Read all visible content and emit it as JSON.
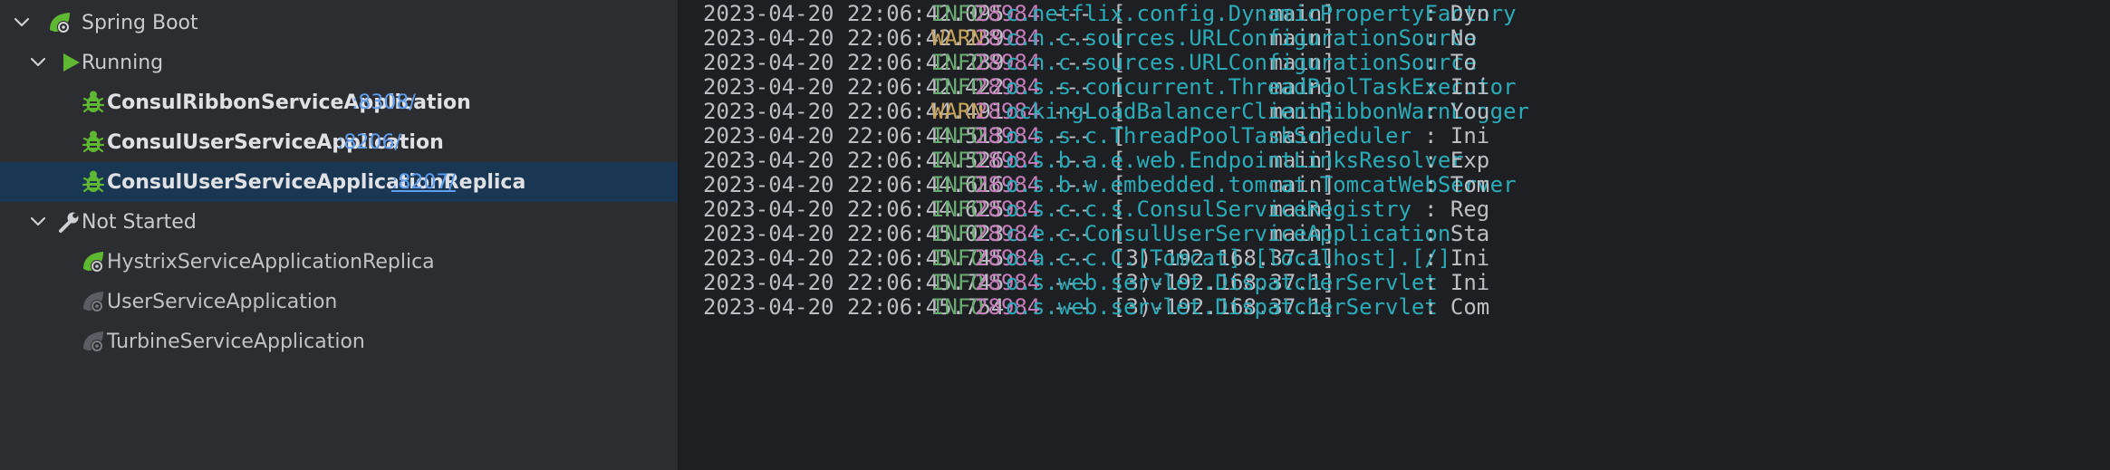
{
  "tree": {
    "root": {
      "label": "Spring Boot"
    },
    "running": {
      "label": "Running",
      "apps": [
        {
          "name": "ConsulRibbonServiceApplication",
          "port": ":8308/"
        },
        {
          "name": "ConsulUserServiceApplication",
          "port": ":8206/"
        },
        {
          "name": "ConsulUserServiceApplicationReplica",
          "port": ":8207/"
        }
      ]
    },
    "not_started": {
      "label": "Not Started",
      "apps": [
        {
          "name": "HystrixServiceApplicationReplica"
        },
        {
          "name": "UserServiceApplication"
        },
        {
          "name": "TurbineServiceApplication"
        }
      ]
    }
  },
  "console": {
    "lines": [
      {
        "ts": "2023-04-20 22:06:42.095",
        "level": "INFO",
        "pid": "28984",
        "sep": "---",
        "thread": "[           main]",
        "logger": "c.netflix.config.DynamicPropertyFactory",
        "msg": ": Dyn"
      },
      {
        "ts": "2023-04-20 22:06:42.239",
        "level": "WARN",
        "pid": "28984",
        "sep": "---",
        "thread": "[           main]",
        "logger": "c.n.c.sources.URLConfigurationSource",
        "msg": ": No"
      },
      {
        "ts": "2023-04-20 22:06:42.239",
        "level": "INFO",
        "pid": "28984",
        "sep": "---",
        "thread": "[           main]",
        "logger": "c.n.c.sources.URLConfigurationSource",
        "msg": ": To"
      },
      {
        "ts": "2023-04-20 22:06:42.422",
        "level": "INFO",
        "pid": "28984",
        "sep": "---",
        "thread": "[           main]",
        "logger": "o.s.s.concurrent.ThreadPoolTaskExecutor",
        "msg": ": Ini"
      },
      {
        "ts": "2023-04-20 22:06:44.491",
        "level": "WARN",
        "pid": "28984",
        "sep": "---",
        "thread": "[           main]",
        "logger": "ockingLoadBalancerClientRibbonWarnLogger",
        "msg": ": You"
      },
      {
        "ts": "2023-04-20 22:06:44.513",
        "level": "INFO",
        "pid": "28984",
        "sep": "---",
        "thread": "[           main]",
        "logger": "o.s.s.c.ThreadPoolTaskScheduler",
        "msg": ": Ini"
      },
      {
        "ts": "2023-04-20 22:06:44.526",
        "level": "INFO",
        "pid": "28984",
        "sep": "---",
        "thread": "[           main]",
        "logger": "o.s.b.a.e.web.EndpointLinksResolver",
        "msg": ": Exp"
      },
      {
        "ts": "2023-04-20 22:06:44.616",
        "level": "INFO",
        "pid": "28984",
        "sep": "---",
        "thread": "[           main]",
        "logger": "o.s.b.w.embedded.tomcat.TomcatWebServer",
        "msg": ": Tom"
      },
      {
        "ts": "2023-04-20 22:06:44.625",
        "level": "INFO",
        "pid": "28984",
        "sep": "---",
        "thread": "[           main]",
        "logger": "o.s.c.c.s.ConsulServiceRegistry",
        "msg": ": Reg"
      },
      {
        "ts": "2023-04-20 22:06:45.023",
        "level": "INFO",
        "pid": "28984",
        "sep": "---",
        "thread": "[           main]",
        "logger": "c.e.c.ConsulUserServiceApplication",
        "msg": ": Sta"
      },
      {
        "ts": "2023-04-20 22:06:45.745",
        "level": "INFO",
        "pid": "28984",
        "sep": "---",
        "thread": "[3)-192.168.37.1]",
        "logger": "o.a.c.c.C.[Tomcat].[localhost].[/]",
        "msg": ": Ini"
      },
      {
        "ts": "2023-04-20 22:06:45.745",
        "level": "INFO",
        "pid": "28984",
        "sep": "---",
        "thread": "[3)-192.168.37.1]",
        "logger": "o.s.web.servlet.DispatcherServlet",
        "msg": ": Ini"
      },
      {
        "ts": "2023-04-20 22:06:45.754",
        "level": "INFO",
        "pid": "28984",
        "sep": "---",
        "thread": "[3)-192.168.37.1]",
        "logger": "o.s.web.servlet.DispatcherServlet",
        "msg": ": Com"
      }
    ]
  },
  "colors": {
    "info": "#6aab73",
    "warn": "#c7a45a",
    "pid": "#c77dbb",
    "logger": "#2aacb8",
    "port_link": "#5e9df0",
    "selection": "#193653"
  },
  "icons": {
    "expand": "chevron-down-icon",
    "spring_boot": "spring-boot-icon",
    "running": "run-icon",
    "running_app": "bug-icon",
    "not_started": "wrench-icon",
    "app_stopped": "spring-app-icon"
  }
}
